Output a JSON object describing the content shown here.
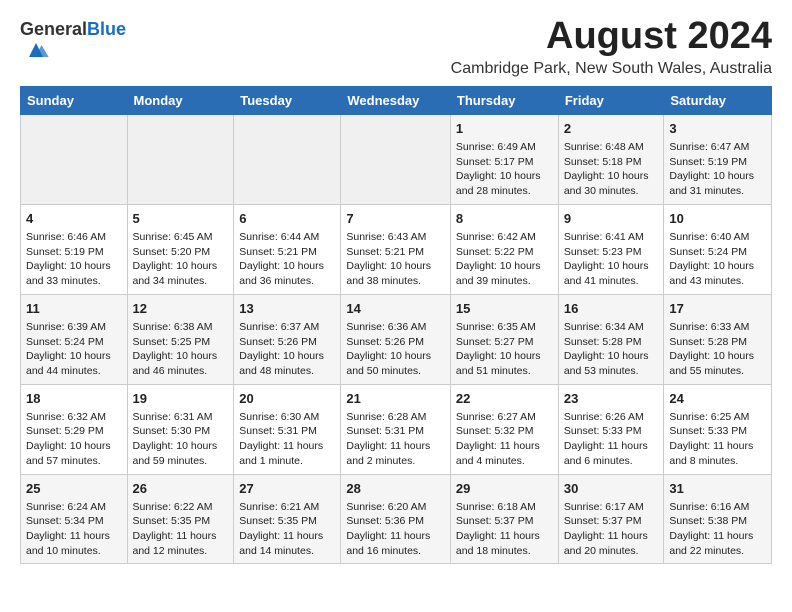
{
  "header": {
    "logo_general": "General",
    "logo_blue": "Blue",
    "title": "August 2024",
    "subtitle": "Cambridge Park, New South Wales, Australia"
  },
  "calendar": {
    "days_of_week": [
      "Sunday",
      "Monday",
      "Tuesday",
      "Wednesday",
      "Thursday",
      "Friday",
      "Saturday"
    ],
    "weeks": [
      [
        {
          "day": "",
          "info": ""
        },
        {
          "day": "",
          "info": ""
        },
        {
          "day": "",
          "info": ""
        },
        {
          "day": "",
          "info": ""
        },
        {
          "day": "1",
          "info": "Sunrise: 6:49 AM\nSunset: 5:17 PM\nDaylight: 10 hours\nand 28 minutes."
        },
        {
          "day": "2",
          "info": "Sunrise: 6:48 AM\nSunset: 5:18 PM\nDaylight: 10 hours\nand 30 minutes."
        },
        {
          "day": "3",
          "info": "Sunrise: 6:47 AM\nSunset: 5:19 PM\nDaylight: 10 hours\nand 31 minutes."
        }
      ],
      [
        {
          "day": "4",
          "info": "Sunrise: 6:46 AM\nSunset: 5:19 PM\nDaylight: 10 hours\nand 33 minutes."
        },
        {
          "day": "5",
          "info": "Sunrise: 6:45 AM\nSunset: 5:20 PM\nDaylight: 10 hours\nand 34 minutes."
        },
        {
          "day": "6",
          "info": "Sunrise: 6:44 AM\nSunset: 5:21 PM\nDaylight: 10 hours\nand 36 minutes."
        },
        {
          "day": "7",
          "info": "Sunrise: 6:43 AM\nSunset: 5:21 PM\nDaylight: 10 hours\nand 38 minutes."
        },
        {
          "day": "8",
          "info": "Sunrise: 6:42 AM\nSunset: 5:22 PM\nDaylight: 10 hours\nand 39 minutes."
        },
        {
          "day": "9",
          "info": "Sunrise: 6:41 AM\nSunset: 5:23 PM\nDaylight: 10 hours\nand 41 minutes."
        },
        {
          "day": "10",
          "info": "Sunrise: 6:40 AM\nSunset: 5:24 PM\nDaylight: 10 hours\nand 43 minutes."
        }
      ],
      [
        {
          "day": "11",
          "info": "Sunrise: 6:39 AM\nSunset: 5:24 PM\nDaylight: 10 hours\nand 44 minutes."
        },
        {
          "day": "12",
          "info": "Sunrise: 6:38 AM\nSunset: 5:25 PM\nDaylight: 10 hours\nand 46 minutes."
        },
        {
          "day": "13",
          "info": "Sunrise: 6:37 AM\nSunset: 5:26 PM\nDaylight: 10 hours\nand 48 minutes."
        },
        {
          "day": "14",
          "info": "Sunrise: 6:36 AM\nSunset: 5:26 PM\nDaylight: 10 hours\nand 50 minutes."
        },
        {
          "day": "15",
          "info": "Sunrise: 6:35 AM\nSunset: 5:27 PM\nDaylight: 10 hours\nand 51 minutes."
        },
        {
          "day": "16",
          "info": "Sunrise: 6:34 AM\nSunset: 5:28 PM\nDaylight: 10 hours\nand 53 minutes."
        },
        {
          "day": "17",
          "info": "Sunrise: 6:33 AM\nSunset: 5:28 PM\nDaylight: 10 hours\nand 55 minutes."
        }
      ],
      [
        {
          "day": "18",
          "info": "Sunrise: 6:32 AM\nSunset: 5:29 PM\nDaylight: 10 hours\nand 57 minutes."
        },
        {
          "day": "19",
          "info": "Sunrise: 6:31 AM\nSunset: 5:30 PM\nDaylight: 10 hours\nand 59 minutes."
        },
        {
          "day": "20",
          "info": "Sunrise: 6:30 AM\nSunset: 5:31 PM\nDaylight: 11 hours\nand 1 minute."
        },
        {
          "day": "21",
          "info": "Sunrise: 6:28 AM\nSunset: 5:31 PM\nDaylight: 11 hours\nand 2 minutes."
        },
        {
          "day": "22",
          "info": "Sunrise: 6:27 AM\nSunset: 5:32 PM\nDaylight: 11 hours\nand 4 minutes."
        },
        {
          "day": "23",
          "info": "Sunrise: 6:26 AM\nSunset: 5:33 PM\nDaylight: 11 hours\nand 6 minutes."
        },
        {
          "day": "24",
          "info": "Sunrise: 6:25 AM\nSunset: 5:33 PM\nDaylight: 11 hours\nand 8 minutes."
        }
      ],
      [
        {
          "day": "25",
          "info": "Sunrise: 6:24 AM\nSunset: 5:34 PM\nDaylight: 11 hours\nand 10 minutes."
        },
        {
          "day": "26",
          "info": "Sunrise: 6:22 AM\nSunset: 5:35 PM\nDaylight: 11 hours\nand 12 minutes."
        },
        {
          "day": "27",
          "info": "Sunrise: 6:21 AM\nSunset: 5:35 PM\nDaylight: 11 hours\nand 14 minutes."
        },
        {
          "day": "28",
          "info": "Sunrise: 6:20 AM\nSunset: 5:36 PM\nDaylight: 11 hours\nand 16 minutes."
        },
        {
          "day": "29",
          "info": "Sunrise: 6:18 AM\nSunset: 5:37 PM\nDaylight: 11 hours\nand 18 minutes."
        },
        {
          "day": "30",
          "info": "Sunrise: 6:17 AM\nSunset: 5:37 PM\nDaylight: 11 hours\nand 20 minutes."
        },
        {
          "day": "31",
          "info": "Sunrise: 6:16 AM\nSunset: 5:38 PM\nDaylight: 11 hours\nand 22 minutes."
        }
      ]
    ]
  }
}
